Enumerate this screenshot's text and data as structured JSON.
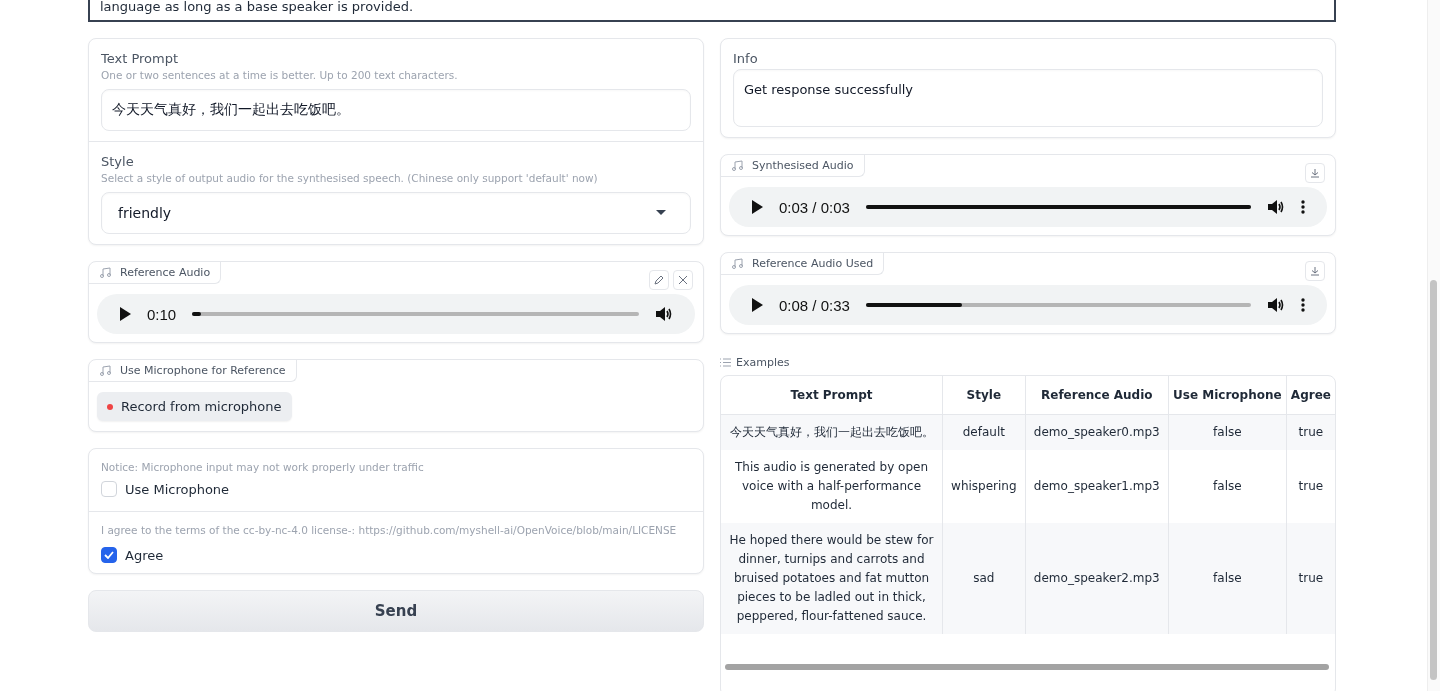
{
  "description": {
    "text": "language as long as a base speaker is provided."
  },
  "text_prompt": {
    "label": "Text Prompt",
    "info": "One or two sentences at a time is better. Up to 200 text characters.",
    "value": "今天天气真好，我们一起出去吃饭吧。"
  },
  "style": {
    "label": "Style",
    "info": "Select a style of output audio for the synthesised speech. (Chinese only support 'default' now)",
    "value": "friendly"
  },
  "reference_audio": {
    "label": "Reference Audio",
    "kind": "input",
    "time": "0:10",
    "level": 0.02,
    "menu_button": false
  },
  "microphone_audio": {
    "label": "Use Microphone for Reference",
    "button": "Record from microphone"
  },
  "options": [
    {
      "info": "Notice: Microphone input may not work properly under traffic",
      "label": "Use Microphone",
      "checked": false
    },
    {
      "info": "I agree to the terms of the cc-by-nc-4.0 license-: https://github.com/myshell-ai/OpenVoice/blob/main/LICENSE",
      "label": "Agree",
      "checked": true
    }
  ],
  "send_button": "Send",
  "info": {
    "label": "Info",
    "value": "Get response successfully"
  },
  "outputs": [
    {
      "label": "Synthesised Audio",
      "kind": "output",
      "time": "0:03 / 0:03",
      "level": 1.0,
      "menu_button": true
    },
    {
      "label": "Reference Audio Used",
      "kind": "output",
      "time": "0:08 / 0:33",
      "level": 0.25,
      "menu_button": true
    }
  ],
  "examples": {
    "label": "Examples",
    "columns": [
      "Text Prompt",
      "Style",
      "Reference Audio",
      "Use Microphone",
      "Agree"
    ],
    "rows": [
      [
        "今天天气真好，我们一起出去吃饭吧。",
        "default",
        "demo_speaker0.mp3",
        "false",
        "true"
      ],
      [
        "This audio is generated by open voice with a half-performance model.",
        "whispering",
        "demo_speaker1.mp3",
        "false",
        "true"
      ],
      [
        "He hoped there would be stew for dinner, turnips and carrots and bruised potatoes and fat mutton pieces to be ladled out in thick, peppered, flour-fattened sauce.",
        "sad",
        "demo_speaker2.mp3",
        "false",
        "true"
      ]
    ]
  }
}
